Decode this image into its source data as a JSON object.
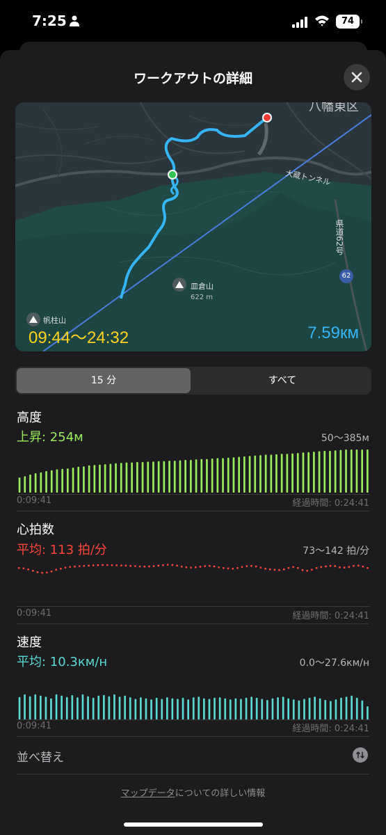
{
  "status_bar": {
    "time": "7:25",
    "battery": "74"
  },
  "sheet": {
    "title": "ワークアウトの詳細"
  },
  "map": {
    "time_range": "09:44～24:32",
    "distance": "7.59км",
    "labels": {
      "peak_sarakura": "皿倉山",
      "peak_elevation": "622 m",
      "peak_hobashira": "帆柱山",
      "tunnel": "大蔵トンネル",
      "route": "県道62号",
      "route_badge": "62",
      "district": "八幡東区"
    }
  },
  "segmented": {
    "active": "15 分",
    "inactive": "すべて"
  },
  "altitude": {
    "title": "高度",
    "stat": "上昇: 254м",
    "range": "50～385м",
    "axis_start": "0:09:41",
    "axis_end": "経過時間: 0:24:41",
    "color": "#9bec5c",
    "bars": [
      0.35,
      0.38,
      0.42,
      0.45,
      0.47,
      0.5,
      0.52,
      0.54,
      0.55,
      0.56,
      0.58,
      0.6,
      0.61,
      0.63,
      0.64,
      0.65,
      0.66,
      0.67,
      0.68,
      0.69,
      0.7,
      0.7,
      0.71,
      0.71,
      0.72,
      0.72,
      0.73,
      0.73,
      0.74,
      0.74,
      0.75,
      0.76,
      0.76,
      0.77,
      0.78,
      0.78,
      0.79,
      0.8,
      0.8,
      0.81,
      0.82,
      0.83,
      0.84,
      0.85,
      0.86,
      0.87,
      0.88,
      0.88,
      0.89,
      0.9,
      0.9,
      0.91,
      0.92,
      0.93,
      0.94,
      0.95,
      0.96,
      0.97,
      0.97,
      0.98,
      0.99,
      1.0,
      1.0,
      1.0,
      1.0,
      1.0
    ]
  },
  "heart_rate": {
    "title": "心拍数",
    "stat": "平均: 113 拍/分",
    "range": "73～142 拍/分",
    "axis_start": "0:09:41",
    "axis_end": "経過時間: 0:24:41",
    "color": "#ff453a",
    "points": [
      0.55,
      0.52,
      0.45,
      0.35,
      0.25,
      0.2,
      0.22,
      0.3,
      0.42,
      0.5,
      0.58,
      0.62,
      0.65,
      0.68,
      0.7,
      0.72,
      0.74,
      0.75,
      0.76,
      0.76,
      0.75,
      0.74,
      0.73,
      0.72,
      0.7,
      0.68,
      0.66,
      0.65,
      0.66,
      0.68,
      0.72,
      0.75,
      0.78,
      0.76,
      0.72,
      0.65,
      0.6,
      0.58,
      0.6,
      0.64,
      0.68,
      0.7,
      0.66,
      0.6,
      0.55,
      0.52,
      0.5,
      0.55,
      0.62,
      0.68,
      0.7,
      0.66,
      0.58,
      0.5,
      0.45,
      0.42,
      0.4,
      0.45,
      0.55,
      0.62,
      0.55,
      0.4,
      0.35,
      0.42,
      0.55,
      0.62,
      0.66,
      0.7,
      0.68,
      0.6,
      0.58,
      0.62,
      0.7,
      0.72,
      0.65,
      0.55
    ]
  },
  "speed": {
    "title": "速度",
    "stat": "平均: 10.3км/н",
    "range": "0.0～27.6км/н",
    "axis_start": "0:09:41",
    "axis_end": "経過時間: 0:24:41",
    "color": "#5ad8d3",
    "bars": [
      0.85,
      0.95,
      0.88,
      0.95,
      0.9,
      0.86,
      0.8,
      0.95,
      0.9,
      0.85,
      0.92,
      0.84,
      0.95,
      0.88,
      0.82,
      0.9,
      0.93,
      0.88,
      0.95,
      0.86,
      0.9,
      0.84,
      0.78,
      0.84,
      0.8,
      0.76,
      0.82,
      0.78,
      0.84,
      0.8,
      0.78,
      0.82,
      0.76,
      0.84,
      0.86,
      0.8,
      0.78,
      0.82,
      0.84,
      0.8,
      0.76,
      0.8,
      0.78,
      0.82,
      0.86,
      0.82,
      0.78,
      0.74,
      0.8,
      0.84,
      0.86,
      0.8,
      0.76,
      0.72,
      0.78,
      0.82,
      0.86,
      0.8,
      0.74,
      0.7,
      0.76,
      0.82,
      0.86,
      0.9,
      0.82,
      0.72,
      0.5
    ]
  },
  "sort": {
    "label": "並べ替え"
  },
  "footer": {
    "link": "マップデータ",
    "text": "についての詳しい情報"
  }
}
